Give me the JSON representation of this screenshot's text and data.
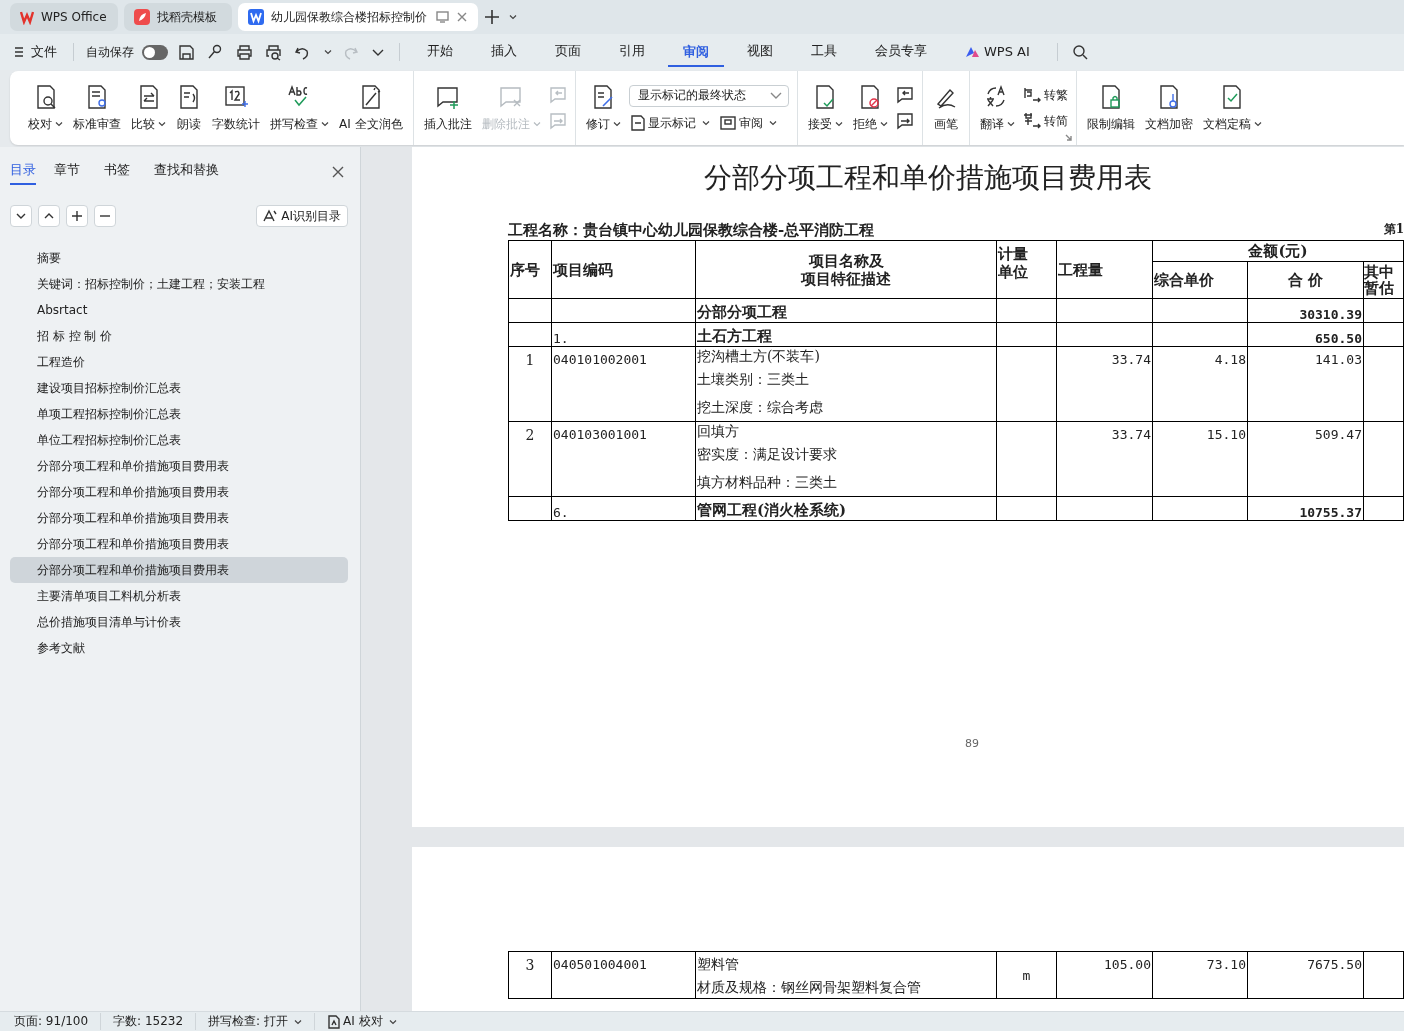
{
  "tabs": [
    {
      "kind": "home",
      "label": "WPS Office",
      "selected": false
    },
    {
      "kind": "template",
      "label": "找稻壳模板",
      "selected": false
    },
    {
      "kind": "document",
      "label": "幼儿园保教综合楼招标控制价",
      "selected": true
    }
  ],
  "menu": {
    "file": "文件",
    "autosave": {
      "label": "自动保存",
      "on": false
    },
    "tabs": [
      {
        "label": "开始",
        "selected": false
      },
      {
        "label": "插入",
        "selected": false
      },
      {
        "label": "页面",
        "selected": false
      },
      {
        "label": "引用",
        "selected": false
      },
      {
        "label": "审阅",
        "selected": true
      },
      {
        "label": "视图",
        "selected": false
      },
      {
        "label": "工具",
        "selected": false
      },
      {
        "label": "会员专享",
        "selected": false
      },
      {
        "label": "WPS AI",
        "selected": false,
        "kind": "ai"
      }
    ]
  },
  "ribbon": {
    "groups": [
      {
        "items": [
          {
            "kind": "big",
            "label": "校对",
            "caret": true,
            "disabled": false
          },
          {
            "kind": "big",
            "label": "标准审查",
            "disabled": false
          },
          {
            "kind": "big",
            "label": "比较",
            "caret": true,
            "disabled": false
          },
          {
            "kind": "big",
            "label": "朗读",
            "disabled": false
          },
          {
            "kind": "big",
            "label": "字数统计",
            "disabled": false
          },
          {
            "kind": "big",
            "label": "拼写检查",
            "caret": true,
            "disabled": false
          },
          {
            "kind": "big",
            "label": "AI 全文润色",
            "disabled": false
          }
        ]
      },
      {
        "items": [
          {
            "kind": "big",
            "label": "插入批注",
            "disabled": false
          },
          {
            "kind": "big",
            "label": "删除批注",
            "caret": true,
            "disabled": true
          },
          {
            "kind": "icons",
            "disabled": true
          }
        ]
      },
      {
        "items": [
          {
            "kind": "big",
            "label": "修订",
            "caret": true,
            "disabled": false
          },
          {
            "kind": "stack",
            "select": "显示标记的最终状态",
            "buttons": [
              {
                "label": "显示标记",
                "caret": true
              },
              {
                "label": "审阅",
                "caret": true
              }
            ]
          }
        ]
      },
      {
        "items": [
          {
            "kind": "big",
            "label": "接受",
            "caret": true,
            "disabled": false
          },
          {
            "kind": "big",
            "label": "拒绝",
            "caret": true,
            "disabled": false
          },
          {
            "kind": "icons",
            "disabled": false
          }
        ]
      },
      {
        "items": [
          {
            "kind": "big",
            "label": "画笔",
            "disabled": false
          }
        ]
      },
      {
        "items": [
          {
            "kind": "big",
            "label": "翻译",
            "caret": true,
            "disabled": false
          },
          {
            "kind": "list",
            "buttons": [
              {
                "label": "转繁"
              },
              {
                "label": "转简"
              }
            ]
          }
        ]
      },
      {
        "items": [
          {
            "kind": "big",
            "label": "限制编辑",
            "disabled": false
          },
          {
            "kind": "big",
            "label": "文档加密",
            "disabled": false
          },
          {
            "kind": "big",
            "label": "文档定稿",
            "caret": true,
            "disabled": false
          }
        ]
      }
    ]
  },
  "sidebar": {
    "tabs": [
      {
        "label": "目录",
        "selected": true
      },
      {
        "label": "章节",
        "selected": false
      },
      {
        "label": "书签",
        "selected": false
      },
      {
        "label": "查找和替换",
        "selected": false
      }
    ],
    "ai_button": "AI识别目录",
    "items": [
      {
        "label": "摘要",
        "selected": false
      },
      {
        "label": "关键词：招标控制价；土建工程；安装工程",
        "selected": false
      },
      {
        "label": "Absrtact",
        "selected": false
      },
      {
        "label": "招 标 控 制 价",
        "selected": false
      },
      {
        "label": "工程造价",
        "selected": false
      },
      {
        "label": "建设项目招标控制价汇总表",
        "selected": false
      },
      {
        "label": "单项工程招标控制价汇总表",
        "selected": false
      },
      {
        "label": "单位工程招标控制价汇总表",
        "selected": false
      },
      {
        "label": "分部分项工程和单价措施项目费用表",
        "selected": false
      },
      {
        "label": "分部分项工程和单价措施项目费用表",
        "selected": false
      },
      {
        "label": "分部分项工程和单价措施项目费用表",
        "selected": false
      },
      {
        "label": "分部分项工程和单价措施项目费用表",
        "selected": false
      },
      {
        "label": "分部分项工程和单价措施项目费用表",
        "selected": true
      },
      {
        "label": "主要清单项目工料机分析表",
        "selected": false
      },
      {
        "label": "总价措施项目清单与计价表",
        "selected": false
      },
      {
        "label": "参考文献",
        "selected": false
      }
    ]
  },
  "document": {
    "title": "分部分项工程和单价措施项目费用表",
    "project": "工程名称：贵台镇中心幼儿园保教综合楼-总平消防工程",
    "page_label": "第1",
    "table": {
      "columns": [
        [
          "序号"
        ],
        [
          "项目编码"
        ],
        [
          "项目名称及",
          "项目特征描述"
        ],
        [
          "计量",
          "单位"
        ],
        [
          "工程量"
        ]
      ],
      "amount_group": "金额(元)",
      "amount_columns": [
        [
          "综合单价"
        ],
        [
          "合 价"
        ],
        [
          "其中",
          "暂估"
        ]
      ],
      "rows": [
        {
          "kind": "group",
          "name": "分部分项工程",
          "total": "30310.39"
        },
        {
          "kind": "group",
          "code": "1.",
          "name": "土石方工程",
          "total": "650.50"
        },
        {
          "kind": "item",
          "no": "1",
          "code": "040101002001",
          "name": "挖沟槽土方(不装车)",
          "features": [
            "土壤类别：三类土",
            "挖土深度：综合考虑"
          ],
          "quantity": "33.74",
          "unit_price": "4.18",
          "total": "141.03"
        },
        {
          "kind": "item",
          "no": "2",
          "code": "040103001001",
          "name": "回填方",
          "features": [
            "密实度：满足设计要求",
            "填方材料品种：三类土"
          ],
          "quantity": "33.74",
          "unit_price": "15.10",
          "total": "509.47"
        },
        {
          "kind": "group",
          "code": "6.",
          "name": "管网工程(消火栓系统)",
          "total": "10755.37"
        }
      ]
    },
    "page_number": "89",
    "next_page_rows": [
      {
        "kind": "item",
        "no": "3",
        "code": "040501004001",
        "name": "塑料管",
        "features": [
          "材质及规格：钢丝网骨架塑料复合管"
        ],
        "unit": "m",
        "quantity": "105.00",
        "unit_price": "73.10",
        "total": "7675.50"
      }
    ]
  },
  "status_bar": {
    "page": "页面: 91/100",
    "words": "字数: 15232",
    "spell": "拼写检查: 打开",
    "ai": "AI 校对"
  }
}
